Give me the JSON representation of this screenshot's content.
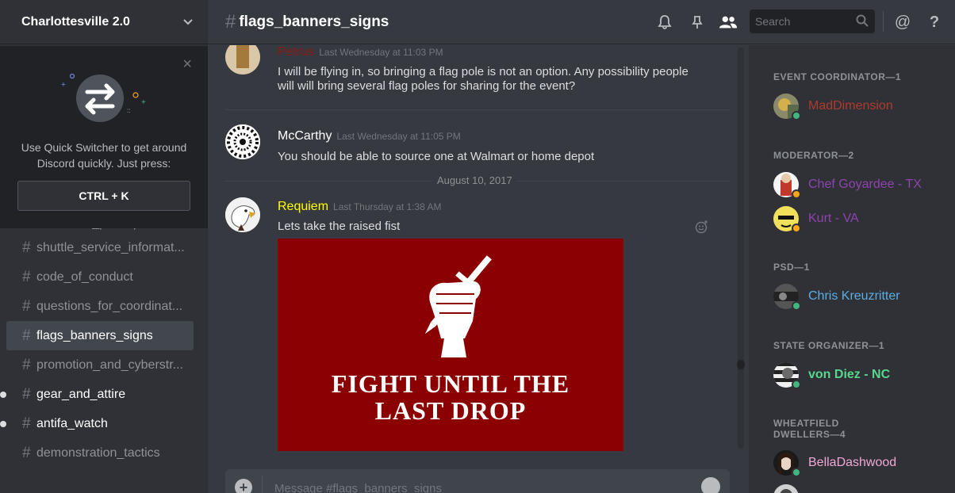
{
  "server": {
    "name": "Charlottesville 2.0"
  },
  "quick_switcher": {
    "text": "Use Quick Switcher to get around Discord quickly. Just press:",
    "shortcut": "CTRL + K"
  },
  "channels": [
    {
      "name": "confirmed_participants",
      "partial": true
    },
    {
      "name": "shuttle_service_informat..."
    },
    {
      "name": "code_of_conduct"
    },
    {
      "name": "questions_for_coordinat..."
    },
    {
      "name": "flags_banners_signs",
      "active": true
    },
    {
      "name": "promotion_and_cyberstr..."
    },
    {
      "name": "gear_and_attire",
      "unread": true
    },
    {
      "name": "antifa_watch",
      "unread": true
    },
    {
      "name": "demonstration_tactics"
    }
  ],
  "header": {
    "channel": "flags_banners_signs",
    "search_placeholder": "Search"
  },
  "messages": [
    {
      "author": "Petrus",
      "author_color": "#8b1a1a",
      "timestamp": "Last Wednesday at 11:03 PM",
      "text": "I will be flying in, so bringing a flag pole is not an option. Any possibility people will will bring several flag poles for sharing for the event?"
    },
    {
      "author": "McCarthy",
      "author_color": "#ffffff",
      "timestamp": "Last Wednesday at 11:05 PM",
      "text": "You should be able to source one at Walmart or home depot"
    },
    {
      "author": "Requiem",
      "author_color": "#ffff00",
      "timestamp": "Last Thursday at 1:38 AM",
      "text": "Lets take the raised fist"
    }
  ],
  "date_divider": "August 10, 2017",
  "embed": {
    "line1": "FIGHT UNTIL THE",
    "line2": "LAST DROP",
    "bg": "#8b0000"
  },
  "composer": {
    "placeholder": "Message #flags_banners_signs"
  },
  "members": {
    "roles": [
      {
        "label": "EVENT COORDINATOR—1"
      },
      {
        "label": "MODERATOR—2"
      },
      {
        "label": "PSD—1"
      },
      {
        "label": "STATE ORGANIZER—1"
      },
      {
        "label": "WHEATFIELD DWELLERS—4"
      }
    ],
    "people": [
      {
        "name": "MadDimension",
        "color": "#b03a2e",
        "status": "online"
      },
      {
        "name": "Chef Goyardee - TX",
        "color": "#8e44ad",
        "status": "idle"
      },
      {
        "name": "Kurt - VA",
        "color": "#8e44ad",
        "status": "idle"
      },
      {
        "name": "Chris Kreuzritter",
        "color": "#5dade2",
        "status": "online"
      },
      {
        "name": "von Diez - NC",
        "color": "#58d68d",
        "status": "online"
      },
      {
        "name": "BellaDashwood",
        "color": "#f1a7d6",
        "status": "online"
      }
    ]
  },
  "colors": {
    "online": "#43b581",
    "idle": "#faa61a"
  }
}
